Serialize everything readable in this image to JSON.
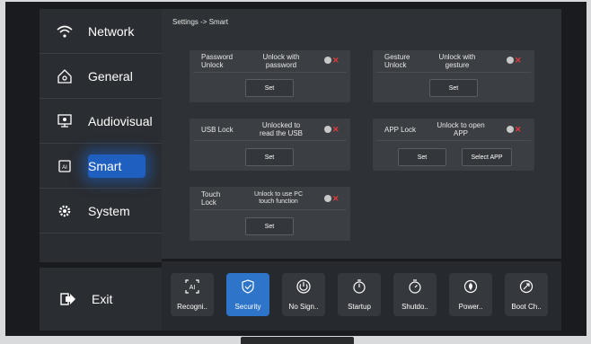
{
  "breadcrumb": "Settings -> Smart",
  "sidebar": {
    "items": [
      {
        "label": "Network",
        "icon": "wifi-icon"
      },
      {
        "label": "General",
        "icon": "home-icon"
      },
      {
        "label": "Audiovisual",
        "icon": "display-icon"
      },
      {
        "label": "Smart",
        "icon": "ai-chip-icon"
      },
      {
        "label": "System",
        "icon": "system-gear-icon"
      }
    ],
    "active": "Smart",
    "exit_label": "Exit"
  },
  "cards": {
    "password": {
      "title": "Password Unlock",
      "title_l1": "Password",
      "title_l2": "Unlock",
      "desc_l1": "Unlock with",
      "desc_l2": "password",
      "set": "Set",
      "enabled": false
    },
    "gesture": {
      "title_l1": "Gesture",
      "title_l2": "Unlock",
      "desc_l1": "Unlock with",
      "desc_l2": "gesture",
      "set": "Set",
      "enabled": false
    },
    "usb": {
      "title": "USB Lock",
      "desc_l1": "Unlocked to",
      "desc_l2": "read the USB",
      "set": "Set",
      "enabled": false
    },
    "app": {
      "title": "APP Lock",
      "desc_l1": "Unlock to open",
      "desc_l2": "APP",
      "set": "Set",
      "select": "Select APP",
      "enabled": false
    },
    "touch": {
      "title_l1": "Touch",
      "title_l2": "Lock",
      "desc_l1": "Unlock to use PC",
      "desc_l2": "touch function",
      "set": "Set",
      "enabled": false
    }
  },
  "tiles": [
    {
      "label": "Recogni..",
      "icon": "ai-recognition-icon"
    },
    {
      "label": "Security",
      "icon": "shield-icon",
      "selected": true
    },
    {
      "label": "No Sign..",
      "icon": "power-icon"
    },
    {
      "label": "Startup",
      "icon": "timer-icon"
    },
    {
      "label": "Shutdo..",
      "icon": "timer-off-icon"
    },
    {
      "label": "Power..",
      "icon": "power-saving-icon"
    },
    {
      "label": "Boot Ch..",
      "icon": "boot-channel-icon"
    }
  ],
  "colors": {
    "accent": "#2e74c9",
    "toggle_off": "#e23a3a",
    "panel": "#3b3e43"
  }
}
